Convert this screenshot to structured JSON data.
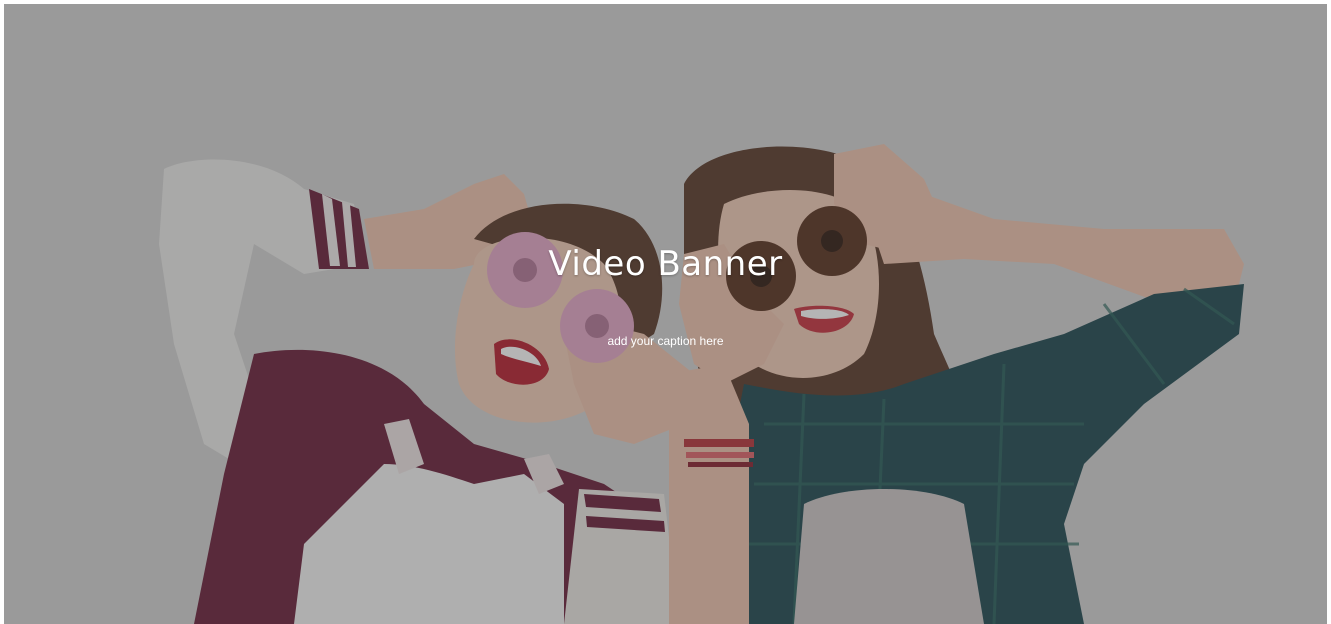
{
  "banner": {
    "title": "Video Banner",
    "caption": "add your caption here",
    "background_icon": "photo-two-girls-donuts",
    "colors": {
      "backdrop": "#c9c9c9",
      "overlay": "#3c3c3c",
      "text": "#ffffff",
      "jacket": "#6b1f3a",
      "plaid_shirt": "#1f4a52",
      "pink_donut": "#e6a9c8",
      "chocolate_donut": "#5a3220",
      "hair": "#5b3a2a"
    }
  }
}
